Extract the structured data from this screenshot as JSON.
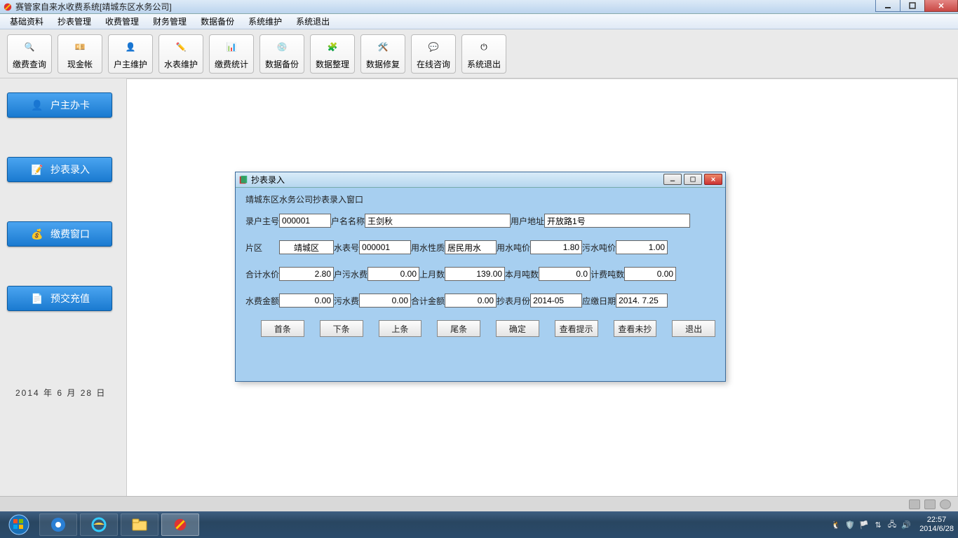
{
  "window": {
    "title": "赛管家自来水收费系统[靖城东区水务公司]"
  },
  "menu": {
    "items": [
      "基础资料",
      "抄表管理",
      "收费管理",
      "财务管理",
      "数据备份",
      "系统维护",
      "系统退出"
    ]
  },
  "toolbar": {
    "items": [
      {
        "label": "缴费查询",
        "icon": "🔍"
      },
      {
        "label": "现金帐",
        "icon": "💴"
      },
      {
        "label": "户主维护",
        "icon": "👤"
      },
      {
        "label": "水表维护",
        "icon": "✏️"
      },
      {
        "label": "缴费统计",
        "icon": "📊"
      },
      {
        "label": "数据备份",
        "icon": "💿"
      },
      {
        "label": "数据整理",
        "icon": "🧩"
      },
      {
        "label": "数据修复",
        "icon": "🛠️"
      },
      {
        "label": "在线咨询",
        "icon": "💬"
      },
      {
        "label": "系统退出",
        "icon": "⏻"
      }
    ]
  },
  "sidebar": {
    "items": [
      {
        "label": "户主办卡",
        "icon": "👤"
      },
      {
        "label": "抄表录入",
        "icon": "📝"
      },
      {
        "label": "缴费窗口",
        "icon": "💰"
      },
      {
        "label": "预交充值",
        "icon": "📄"
      }
    ],
    "date_text": "2014 年  6 月 28 日"
  },
  "dialog": {
    "title": "抄表录入",
    "subtitle": "靖城东区水务公司抄表录入窗口",
    "fields": {
      "account_label": "录户主号",
      "account": "000001",
      "name_label": "户名名称",
      "name": "王剑秋",
      "addr_label": "用户地址",
      "addr": "开放路1号",
      "area_label": "片区",
      "area": "靖城区",
      "meter_label": "水表号",
      "meter": "000001",
      "usage_label": "用水性质",
      "usage": "居民用水",
      "price_label": "用水吨价",
      "price": "1.80",
      "sewage_price_label": "污水吨价",
      "sewage_price": "1.00",
      "total_price_label": "合计水价",
      "total_price": "2.80",
      "hu_sewage_label": "户污水费",
      "hu_sewage": "0.00",
      "last_label": "上月数",
      "last": "139.00",
      "this_label": "本月吨数",
      "this": "0.0",
      "charge_ton_label": "计费吨数",
      "charge_ton": "0.00",
      "water_fee_label": "水费金额",
      "water_fee": "0.00",
      "sewage_fee_label": "污水费",
      "sewage_fee": "0.00",
      "total_fee_label": "合计金额",
      "total_fee": "0.00",
      "read_month_label": "抄表月份",
      "read_month": "2014-05",
      "due_label": "应缴日期",
      "due": "2014. 7.25"
    },
    "buttons": [
      "首条",
      "下条",
      "上条",
      "尾条",
      "确定",
      "查看提示",
      "查看未抄",
      "退出"
    ]
  },
  "status_strip": {
    "faint_text": ""
  },
  "taskbar": {
    "clock_time": "22:57",
    "clock_date": "2014/6/28"
  }
}
